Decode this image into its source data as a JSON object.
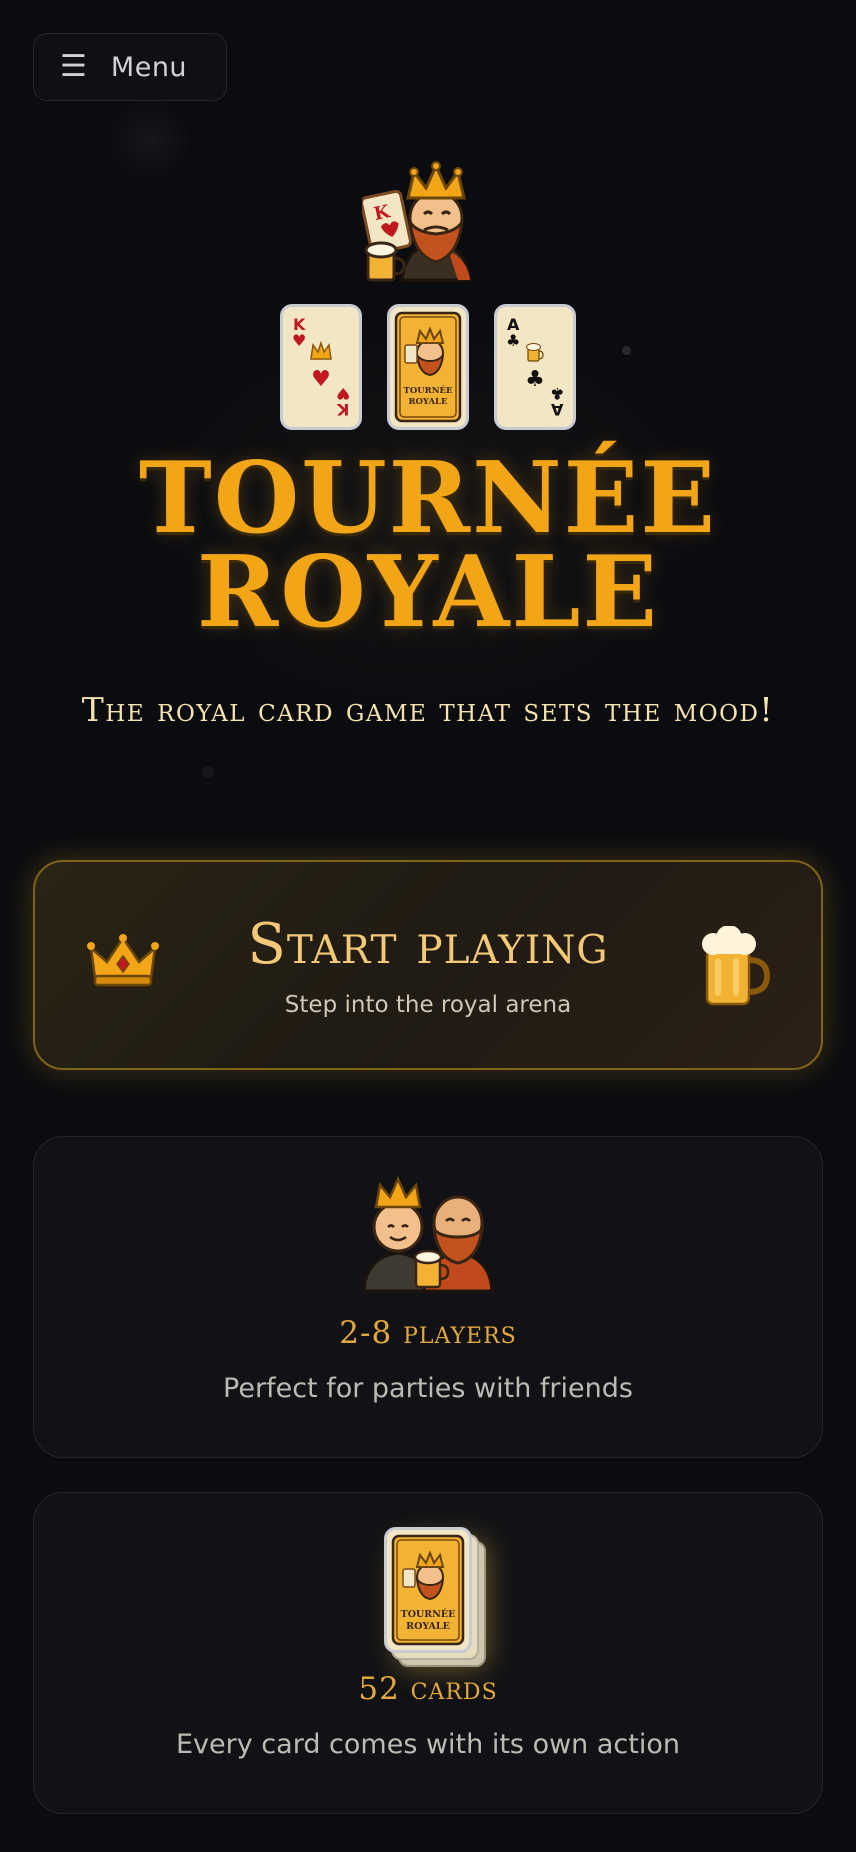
{
  "menu": {
    "icon": "hamburger-icon",
    "label": "Menu"
  },
  "hero": {
    "mascot": "king-mascot",
    "cards": [
      {
        "rank": "K",
        "suit": "♥",
        "top_icon": "crown-icon",
        "color": "red"
      },
      {
        "type": "card-back"
      },
      {
        "rank": "A",
        "suit": "♣",
        "top_icon": "beer-icon",
        "color": "black"
      }
    ],
    "card_back_text": "TOURNÉE ROYALE",
    "title_line1": "TOURNÉE",
    "title_line2": "ROYALE",
    "tagline": "The royal card game that sets the mood!"
  },
  "start_button": {
    "title": "Start playing",
    "subtitle": "Step into the royal arena",
    "left_icon": "crown-icon",
    "right_icon": "beer-mug-icon"
  },
  "features": [
    {
      "icon": "two-friends-icon",
      "title": "2-8 players",
      "description": "Perfect for parties with friends"
    },
    {
      "icon": "card-deck-icon",
      "title": "52 cards",
      "description": "Every card comes with its own action"
    }
  ],
  "colors": {
    "background": "#0b0c10",
    "accent": "#f2a516",
    "cream": "#f6e3ad"
  }
}
